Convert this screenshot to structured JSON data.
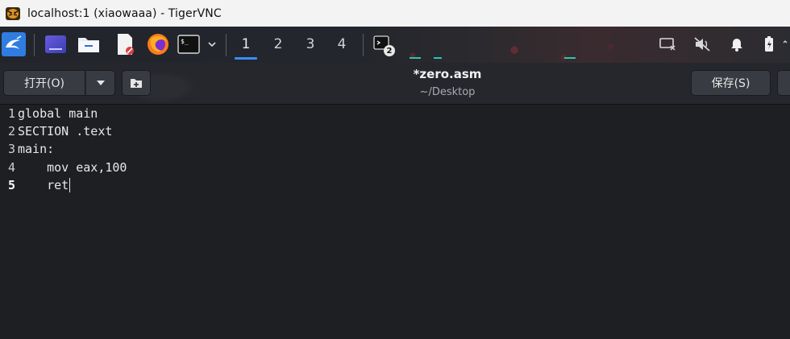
{
  "vnc_window": {
    "title": "localhost:1 (xiaowaaa) - TigerVNC"
  },
  "panel": {
    "launchers": [
      "kali-menu-icon",
      "desktop-icon",
      "file-manager-icon",
      "text-editor-icon",
      "firefox-icon",
      "terminal-icon"
    ],
    "workspaces": [
      "1",
      "2",
      "3",
      "4"
    ],
    "active_workspace": "1",
    "terminal_badge": "2",
    "tray": [
      "display-icon",
      "mute-icon",
      "bell-icon",
      "battery-icon"
    ]
  },
  "headerbar": {
    "open_label": "打开(O)",
    "save_label": "保存(S)",
    "doc_title": "*zero.asm",
    "doc_path": "~/Desktop"
  },
  "editor": {
    "lines": [
      {
        "n": "1",
        "text": "global main"
      },
      {
        "n": "2",
        "text": "SECTION .text"
      },
      {
        "n": "3",
        "text": "main:"
      },
      {
        "n": "4",
        "text": "    mov eax,100"
      },
      {
        "n": "5",
        "text": "    ret"
      }
    ],
    "current_line": "5"
  },
  "colors": {
    "accent": "#3c8cff",
    "panel_bg": "#23262c",
    "editor_bg": "#1e1f23"
  }
}
